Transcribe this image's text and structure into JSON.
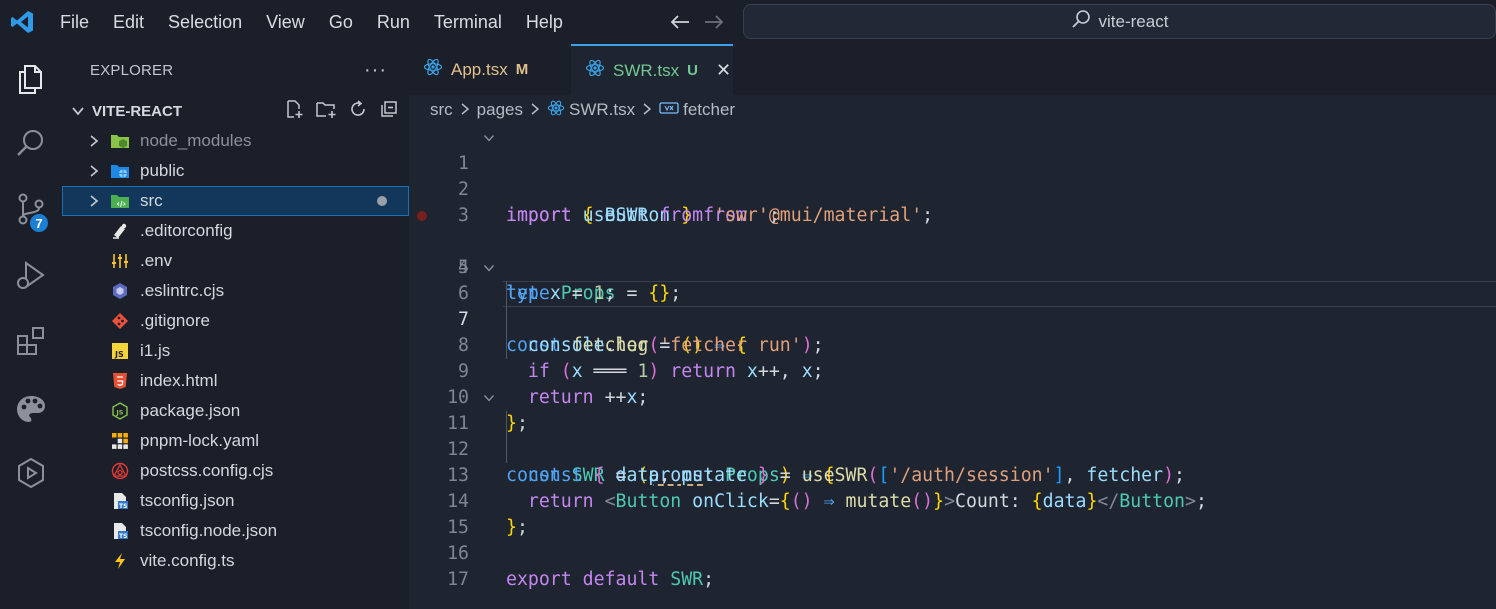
{
  "titlebar": {
    "menu": [
      "File",
      "Edit",
      "Selection",
      "View",
      "Go",
      "Run",
      "Terminal",
      "Help"
    ],
    "search_text": "vite-react",
    "icons": [
      "vscode-logo-icon",
      "back-arrow-icon",
      "forward-arrow-icon",
      "search-icon"
    ]
  },
  "activitybar": {
    "items": [
      "explorer-icon",
      "search-icon",
      "source-control-icon",
      "run-debug-icon",
      "extensions-icon",
      "themes-icon",
      "remote-icon"
    ],
    "source_control_badge": "7"
  },
  "sidebar": {
    "title": "EXPLORER",
    "more": "···",
    "folder": "VITE-REACT",
    "items": [
      {
        "label": "node_modules",
        "type": "folder",
        "icon": "node-folder-icon",
        "dim": true
      },
      {
        "label": "public",
        "type": "folder",
        "icon": "public-folder-icon"
      },
      {
        "label": "src",
        "type": "folder",
        "icon": "src-folder-icon",
        "selected": true,
        "modified": true
      },
      {
        "label": ".editorconfig",
        "type": "file",
        "icon": "editorconfig-icon"
      },
      {
        "label": ".env",
        "type": "file",
        "icon": "env-icon"
      },
      {
        "label": ".eslintrc.cjs",
        "type": "file",
        "icon": "eslint-icon"
      },
      {
        "label": ".gitignore",
        "type": "file",
        "icon": "git-icon"
      },
      {
        "label": "i1.js",
        "type": "file",
        "icon": "js-icon"
      },
      {
        "label": "index.html",
        "type": "file",
        "icon": "html-icon"
      },
      {
        "label": "package.json",
        "type": "file",
        "icon": "node-json-icon"
      },
      {
        "label": "pnpm-lock.yaml",
        "type": "file",
        "icon": "pnpm-icon"
      },
      {
        "label": "postcss.config.cjs",
        "type": "file",
        "icon": "postcss-icon"
      },
      {
        "label": "tsconfig.json",
        "type": "file",
        "icon": "tsconfig-icon"
      },
      {
        "label": "tsconfig.node.json",
        "type": "file",
        "icon": "tsconfig-icon"
      },
      {
        "label": "vite.config.ts",
        "type": "file",
        "icon": "vite-icon"
      }
    ]
  },
  "editor": {
    "tabs": [
      {
        "label": "App.tsx",
        "mark": "M",
        "active": false
      },
      {
        "label": "SWR.tsx",
        "mark": "U",
        "active": true,
        "close": "✕"
      }
    ],
    "breadcrumb": [
      "src",
      "pages",
      "SWR.tsx",
      "fetcher"
    ],
    "current_line": 7,
    "breakpoint_line": 4,
    "lines": [
      "import { Button } from '@mui/material';",
      "import useSWR from 'swr';",
      "",
      "type Props = {};",
      "let x = 1;",
      "const fetcher = () ⇒ {",
      "  console.log('fetcher run');",
      "  if (x ═══ 1) return x++, x;",
      "  return ++x;",
      "};",
      "const SWR = (props: Props) ⇒ {",
      "  const { data, mutate } = useSWR(['/auth/session'], fetcher);",
      "  return <Button onClick={() ⇒ mutate()}>Count: {data}</Button>;",
      "};",
      "",
      "export default SWR;",
      ""
    ]
  }
}
